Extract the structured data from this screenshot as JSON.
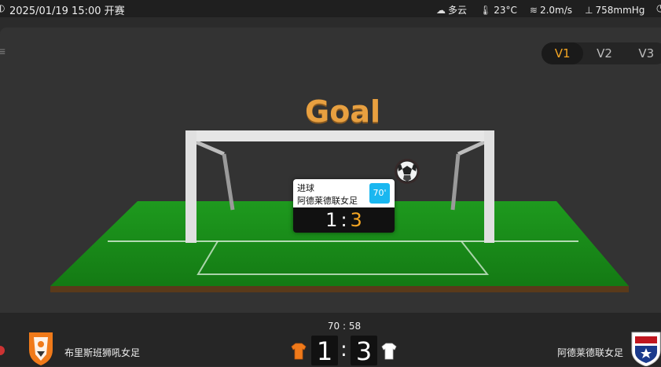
{
  "header": {
    "datetime": "2025/01/19 15:00 开赛",
    "weather": [
      {
        "icon": "cloud-icon",
        "text": "多云"
      },
      {
        "icon": "thermometer-icon",
        "text": "23°C"
      },
      {
        "icon": "wind-icon",
        "text": "2.0m/s"
      },
      {
        "icon": "pressure-icon",
        "text": "758mmHg"
      }
    ]
  },
  "version_tabs": [
    "V1",
    "V2",
    "V3"
  ],
  "active_tab": "V1",
  "animation": {
    "event_title": "Goal",
    "popup": {
      "event_label": "进球",
      "team": "阿德莱德联女足",
      "minute": "70'",
      "home_score": "1",
      "separator": ":",
      "away_score": "3"
    }
  },
  "match": {
    "clock": "70 : 58",
    "home_team": "布里斯班狮吼女足",
    "away_team": "阿德莱德联女足",
    "home_score": "1",
    "away_score": "3",
    "home_kit_color": "#f07a1a",
    "away_kit_color": "#ffffff"
  },
  "colors": {
    "accent": "#f5a623",
    "pitch": "#1c8a1c",
    "minute_badge": "#1ab7f0"
  }
}
